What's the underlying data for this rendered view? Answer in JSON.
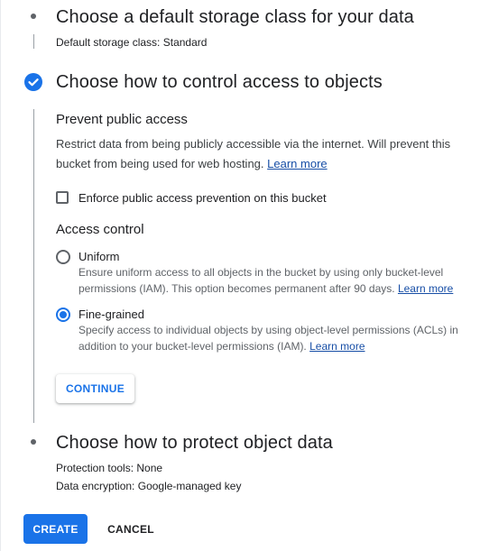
{
  "steps": {
    "storage_class": {
      "title": "Choose a default storage class for your data",
      "summary_label": "Default storage class:",
      "summary_value": "Standard"
    },
    "access": {
      "title": "Choose how to control access to objects",
      "prevent_public": {
        "heading": "Prevent public access",
        "description": "Restrict data from being publicly accessible via the internet. Will prevent this bucket from being used for web hosting.",
        "learn_more": "Learn more",
        "checkbox_label": "Enforce public access prevention on this bucket",
        "checkbox_checked": false
      },
      "access_control": {
        "heading": "Access control",
        "options": [
          {
            "label": "Uniform",
            "description": "Ensure uniform access to all objects in the bucket by using only bucket-level permissions (IAM). This option becomes permanent after 90 days.",
            "learn_more": "Learn more",
            "selected": false
          },
          {
            "label": "Fine-grained",
            "description": "Specify access to individual objects by using object-level permissions (ACLs) in addition to your bucket-level permissions (IAM).",
            "learn_more": "Learn more",
            "selected": true
          }
        ]
      },
      "continue_label": "CONTINUE"
    },
    "protection": {
      "title": "Choose how to protect object data",
      "tools_label": "Protection tools:",
      "tools_value": "None",
      "encryption_label": "Data encryption:",
      "encryption_value": "Google-managed key"
    }
  },
  "actions": {
    "create_label": "CREATE",
    "cancel_label": "CANCEL"
  },
  "colors": {
    "accent": "#1a73e8",
    "text": "#202124",
    "secondary_text": "#5f6368"
  },
  "icons": {
    "completed_step": "check-circle-icon",
    "pending_step": "dot-icon"
  }
}
